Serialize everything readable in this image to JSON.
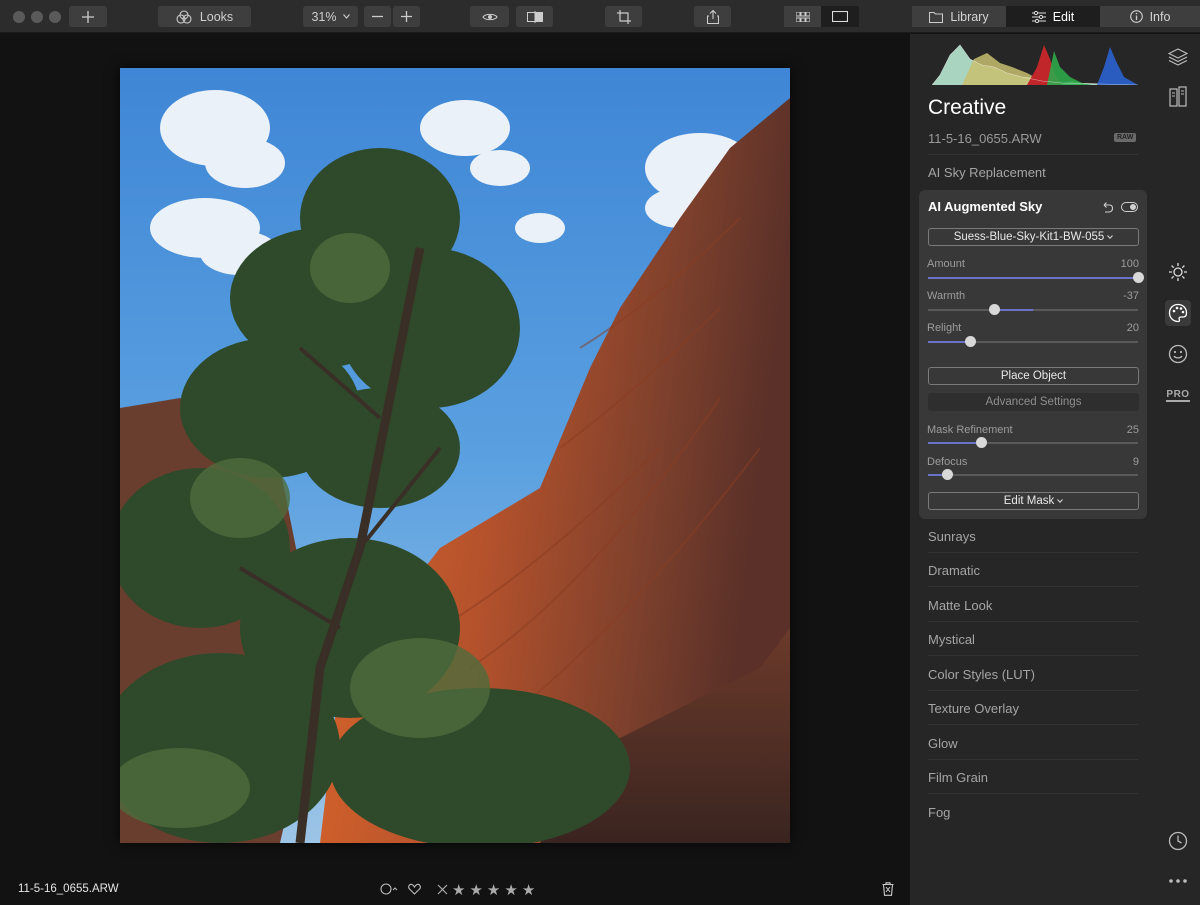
{
  "toolbar": {
    "looks_label": "Looks",
    "zoom_value": "31%",
    "view_tabs": [
      "Library",
      "Edit",
      "Info"
    ],
    "active_tab": "Edit"
  },
  "canvas": {
    "filename": "11-5-16_0655.ARW",
    "rating_stars": [
      "★",
      "★",
      "★",
      "★",
      "★"
    ]
  },
  "panel": {
    "title": "Creative",
    "filename": "11-5-16_0655.ARW",
    "raw_badge": "RAW",
    "sky_replacement_label": "AI Sky Replacement",
    "card": {
      "title": "AI Augmented Sky",
      "sky_preset": "Suess-Blue-Sky-Kit1-BW-055",
      "sliders": [
        {
          "label": "Amount",
          "value": "100",
          "fraction": 1.0,
          "center": false
        },
        {
          "label": "Warmth",
          "value": "-37",
          "fraction": 0.315,
          "center": true
        },
        {
          "label": "Relight",
          "value": "20",
          "fraction": 0.2,
          "center": false
        }
      ],
      "place_object_label": "Place Object",
      "advanced_settings_label": "Advanced Settings",
      "mask_sliders": [
        {
          "label": "Mask Refinement",
          "value": "25",
          "fraction": 0.25
        },
        {
          "label": "Defocus",
          "value": "9",
          "fraction": 0.09
        }
      ],
      "edit_mask_label": "Edit Mask"
    },
    "tools": [
      "Sunrays",
      "Dramatic",
      "Matte Look",
      "Mystical",
      "Color Styles (LUT)",
      "Texture Overlay",
      "Glow",
      "Film Grain",
      "Fog"
    ]
  },
  "iconbar": {
    "pro_label": "PRO"
  },
  "colors": {
    "accent": "#6b73c9",
    "panel_bg": "#262626",
    "card_bg": "#383838"
  }
}
